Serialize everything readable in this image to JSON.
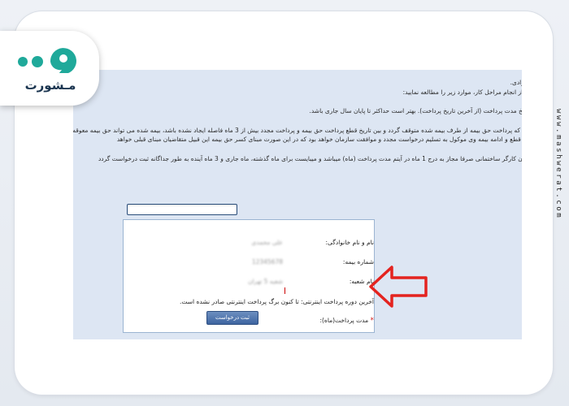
{
  "brand": {
    "logo_text": "مـشورت",
    "vertical_url": "www.mashwerat.com"
  },
  "instructions": [
    "به شده گرادی.",
    "لطفا قبل از انجام مراحل کار، موارد زیر را مطالعه نمایید:",
    "آخرین تاریخ مدت پرداخت (از آخرین تاریخ پرداخت). بهتر است حداکثر تا پایان سال جاری باشد.",
    "در صورتی که پرداخت حق بیمه از طرف بیمه شده متوقف گردد و بین تاریخ قطع پرداخت حق بیمه و پرداخت مجدد بیش از 3 ماه فاصله ایجاد نشده باشد، بیمه شده می تواند حق بیمه معوقه",
    "با سازمان قطع و ادامه بیمه وی موکول به تسلیم درخواست مجدد و موافقت سازمان خواهد بود که در این صورت مبنای کسر حق بیمه این قبیل متقاضیان مبنای قبلی خواهد",
    "بیمه شدگان کارگر ساختمانی صرفا مجاز به درج 1 ماه در آیتم مدت پرداخت (ماه) میباشد و میبایست برای ماه گذشته، ماه جاری و 3 ماه آینده به طور جداگانه ثبت درخواست گردد"
  ],
  "form": {
    "name_label": "نام و نام خانوادگی:",
    "name_value": "علی محمدی",
    "insurance_no_label": "شماره بیمه:",
    "insurance_no_value": "12345678",
    "branch_label": "نام شعبه:",
    "branch_value": "شعبه 5 تهران",
    "last_period_note": "آخرین دوره پرداخت اینترنتی: تا کنون برگ پرداخت اینترنتی صادر نشده است.",
    "duration_label": "مدت پرداخت(ماه):",
    "duration_value": "",
    "required_mark": "*",
    "submit_label": "ثبت درخواست"
  },
  "colors": {
    "accent_arrow": "#e4231f",
    "button": "#3d64a0"
  },
  "icons": {
    "logo": "chat-bubbles-logo-icon",
    "arrow": "pointer-arrow-icon"
  }
}
